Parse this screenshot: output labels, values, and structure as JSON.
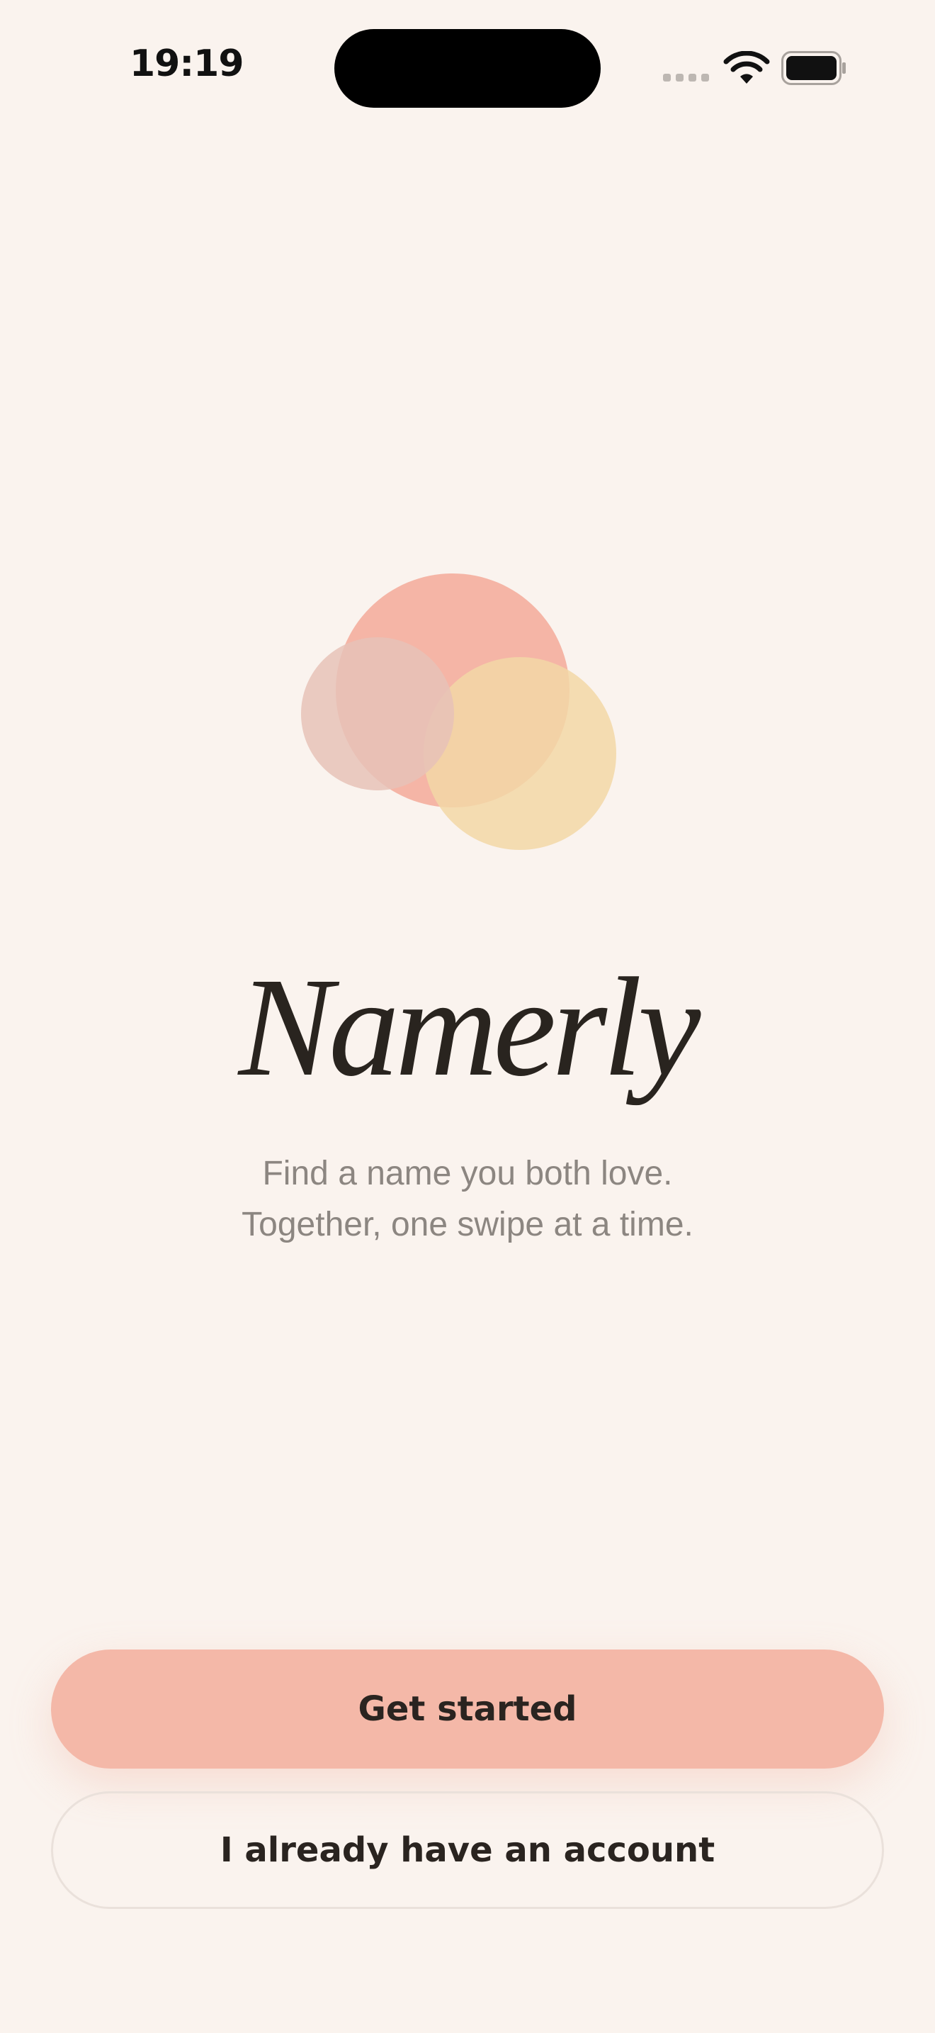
{
  "status_bar": {
    "time": "19:19",
    "wifi_icon": "wifi-icon",
    "battery_icon": "battery-icon",
    "signal_icon": "cellular-signal-icon"
  },
  "brand": {
    "name": "Namerly",
    "logo_icon": "overlapping-circles-logo",
    "colors": {
      "coral": "#F3A999",
      "blush": "#E8C2B5",
      "butter": "#F2D7A6"
    }
  },
  "tagline": {
    "line1": "Find a name you both love.",
    "line2": "Together, one swipe at a time."
  },
  "actions": {
    "primary_label": "Get started",
    "secondary_label": "I already have an account"
  },
  "theme": {
    "background": "#FAF3EE",
    "primary_button": "#F4B8A8",
    "text": "#2A2420",
    "muted_text": "#8C8681"
  }
}
